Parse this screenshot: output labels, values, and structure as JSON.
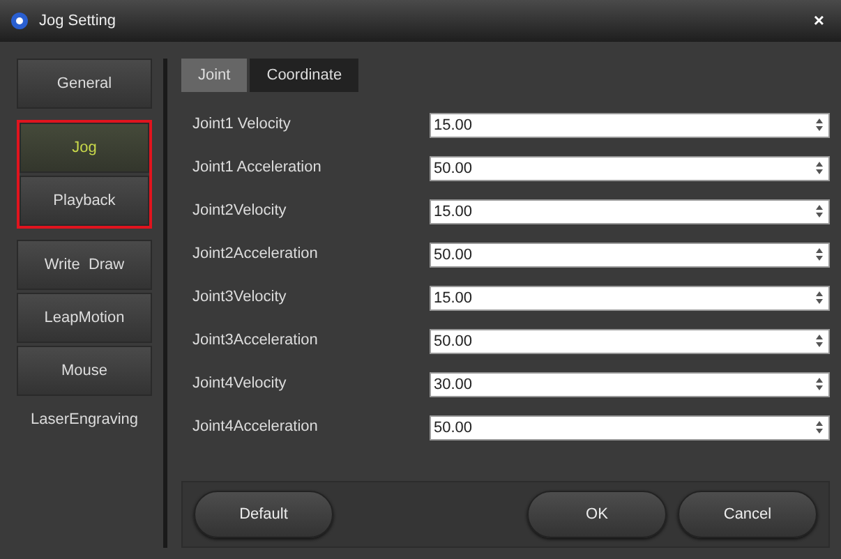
{
  "window": {
    "title": "Jog Setting",
    "close": "×"
  },
  "sidebar": {
    "items": [
      {
        "label": "General",
        "selected": false,
        "highlighted": false
      },
      {
        "label": "Jog",
        "selected": true,
        "highlighted": true
      },
      {
        "label": "Playback",
        "selected": false,
        "highlighted": true
      },
      {
        "label": "Write  Draw",
        "selected": false,
        "highlighted": false
      },
      {
        "label": "LeapMotion",
        "selected": false,
        "highlighted": false
      },
      {
        "label": "Mouse",
        "selected": false,
        "highlighted": false
      },
      {
        "label": "LaserEngraving",
        "selected": false,
        "highlighted": false
      }
    ]
  },
  "tabs": [
    {
      "label": "Joint",
      "selected": true
    },
    {
      "label": "Coordinate",
      "selected": false
    }
  ],
  "fields": [
    {
      "label": "Joint1 Velocity",
      "value": "15.00"
    },
    {
      "label": "Joint1 Acceleration",
      "value": "50.00"
    },
    {
      "label": "Joint2Velocity",
      "value": "15.00"
    },
    {
      "label": "Joint2Acceleration",
      "value": "50.00"
    },
    {
      "label": "Joint3Velocity",
      "value": "15.00"
    },
    {
      "label": "Joint3Acceleration",
      "value": "50.00"
    },
    {
      "label": "Joint4Velocity",
      "value": "30.00"
    },
    {
      "label": "Joint4Acceleration",
      "value": "50.00"
    }
  ],
  "buttons": {
    "left": [
      "Default"
    ],
    "right": [
      "OK",
      "Cancel"
    ]
  }
}
